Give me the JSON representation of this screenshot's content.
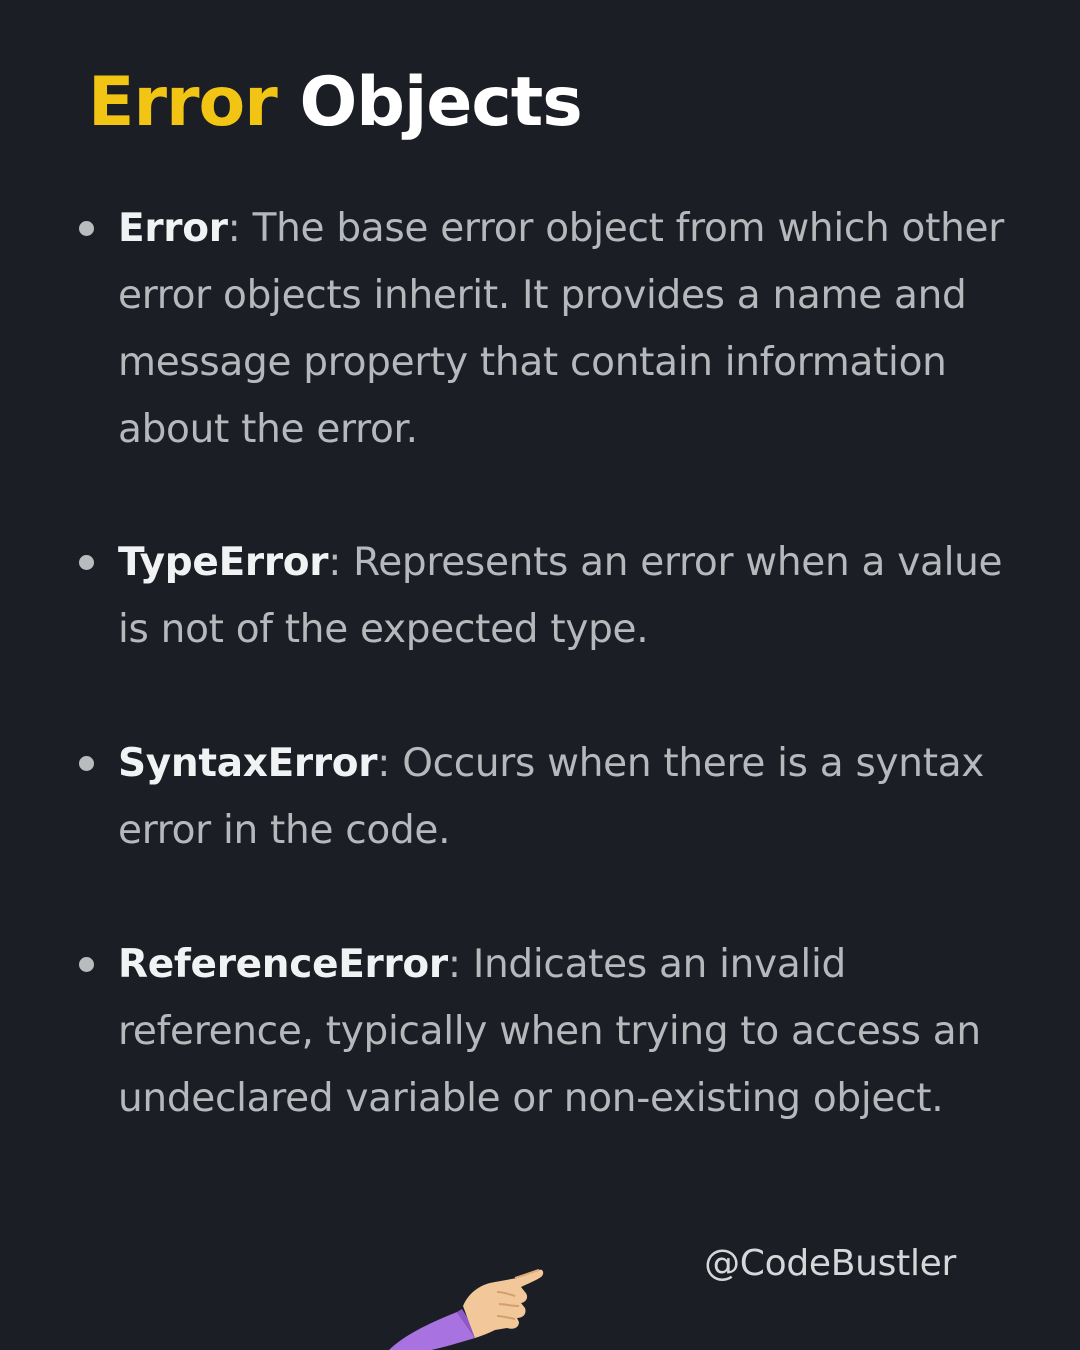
{
  "title": {
    "accent": "Error",
    "rest": "Objects"
  },
  "items": [
    {
      "term": "Error",
      "separator": ":",
      "description": "The base error object from which other error objects inherit. It provides a name and message property that contain information about the error."
    },
    {
      "term": "TypeError",
      "separator": ":",
      "description": "Represents an error when a value is not of the expected type."
    },
    {
      "term": "SyntaxError",
      "separator": ":",
      "description": "Occurs when there is a syntax error in the code."
    },
    {
      "term": "ReferenceError",
      "separator": ":",
      "description": "Indicates an invalid reference, typically when trying to access an undeclared variable or non-existing object."
    }
  ],
  "handle": "@CodeBustler",
  "icons": {
    "pointer": "pointing-hand-icon"
  },
  "colors": {
    "background": "#1b1e24",
    "accent": "#f2c413",
    "title": "#ffffff",
    "body_text": "#b6b8bb",
    "term": "#f1f2f3"
  }
}
